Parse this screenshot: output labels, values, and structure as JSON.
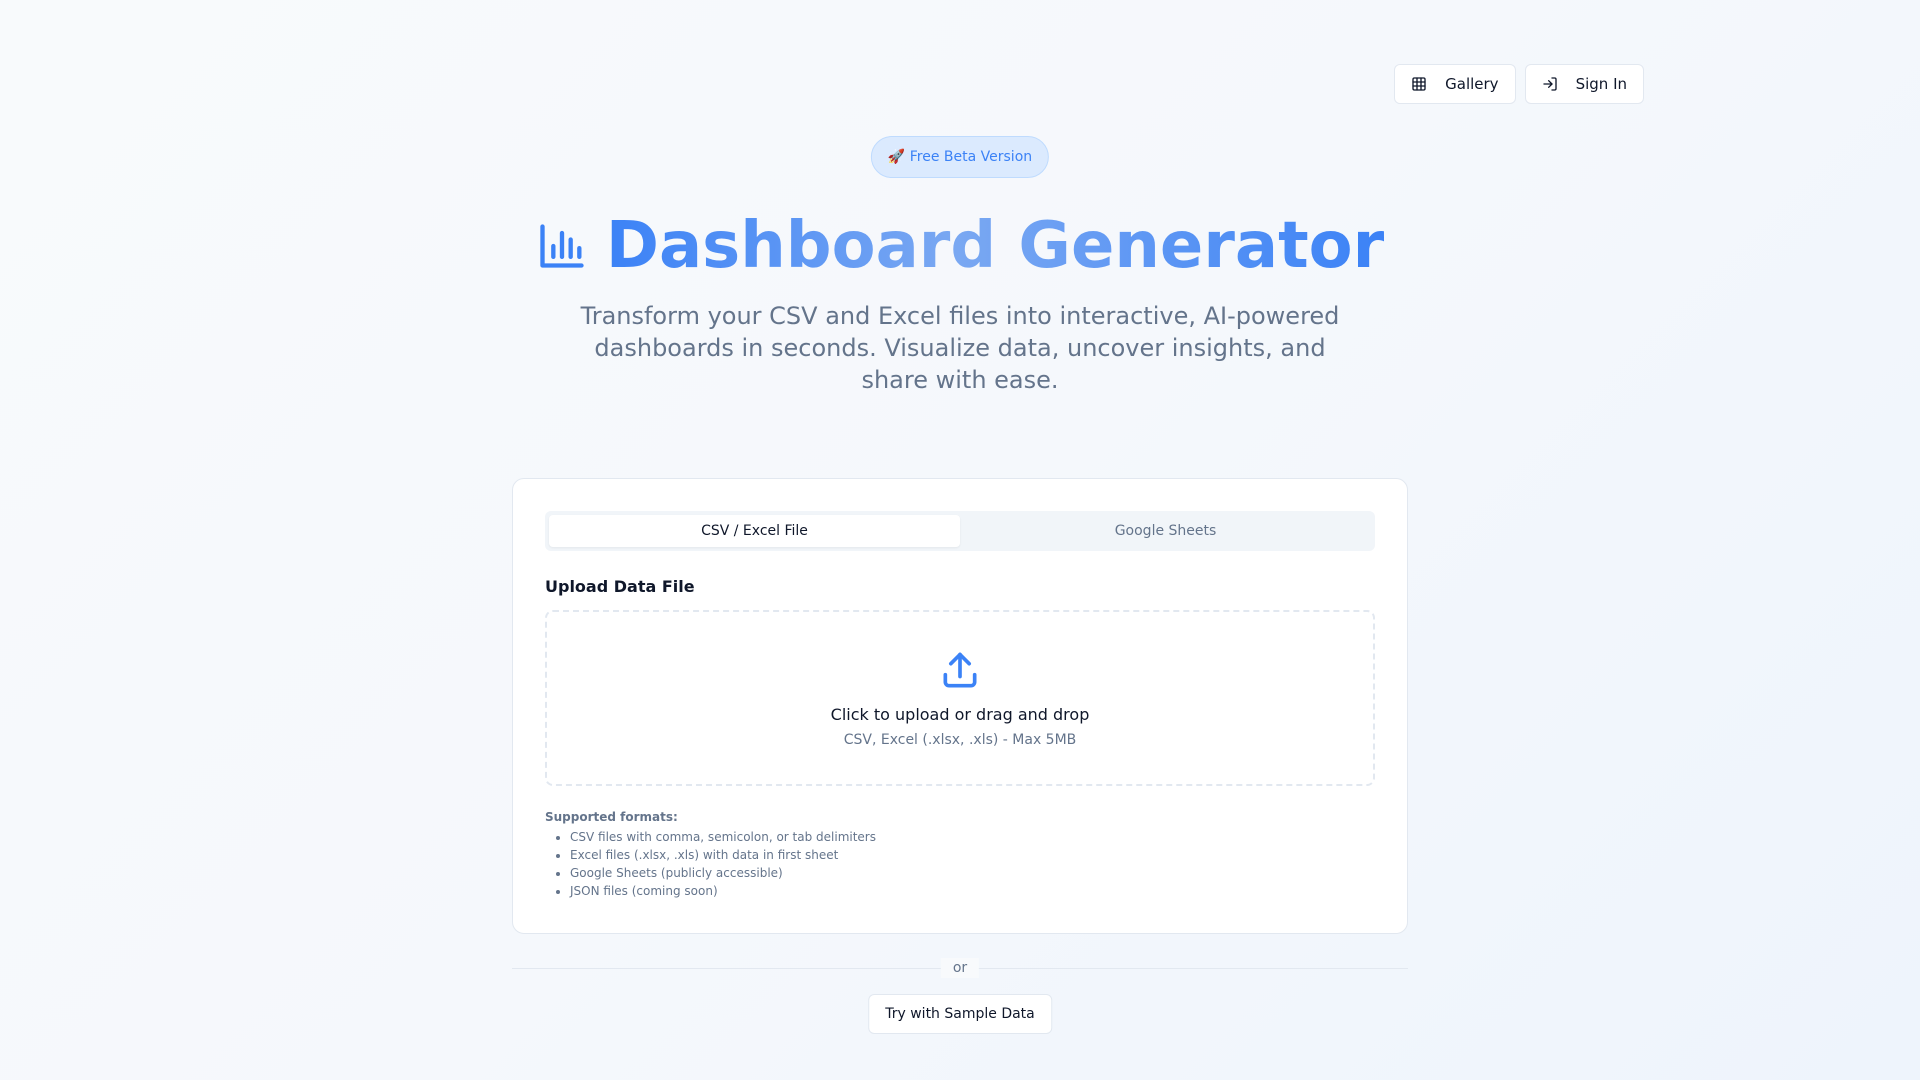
{
  "nav": {
    "gallery_label": "Gallery",
    "gallery_icon": "grid-icon",
    "signin_label": "Sign In",
    "signin_icon": "log-in-icon"
  },
  "badge": {
    "text": "🚀 Free Beta Version"
  },
  "hero": {
    "icon": "bar-chart-icon",
    "title": "Dashboard Generator",
    "subtitle": "Transform your CSV and Excel files into interactive, AI-powered dashboards in seconds. Visualize data, uncover insights, and share with ease."
  },
  "tabs": [
    {
      "label": "CSV / Excel File",
      "active": true
    },
    {
      "label": "Google Sheets",
      "active": false
    }
  ],
  "upload": {
    "label": "Upload Data File",
    "icon": "upload-icon",
    "primary_text": "Click to upload or drag and drop",
    "secondary_text": "CSV, Excel (.xlsx, .xls) - Max 5MB"
  },
  "formats": {
    "title": "Supported formats:",
    "items": [
      "CSV files with comma, semicolon, or tab delimiters",
      "Excel files (.xlsx, .xls) with data in first sheet",
      "Google Sheets (publicly accessible)",
      "JSON files (coming soon)"
    ]
  },
  "divider_text": "or",
  "sample_button": "Try with Sample Data",
  "colors": {
    "accent": "#3b82f6",
    "muted_text": "#64748b",
    "border": "#e2e8f0",
    "badge_bg": "#dbeafe"
  }
}
